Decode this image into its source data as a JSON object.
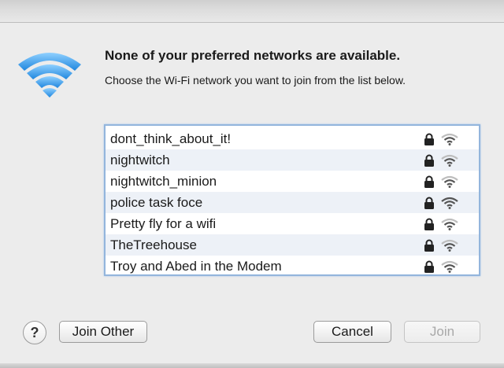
{
  "dialog": {
    "heading": "None of your preferred networks are available.",
    "subtext": "Choose the Wi-Fi network you want to join from the list below."
  },
  "networks": [
    {
      "name": "dont_think_about_it!",
      "secured": true,
      "signal_bars": 3
    },
    {
      "name": "nightwitch",
      "secured": true,
      "signal_bars": 3
    },
    {
      "name": "nightwitch_minion",
      "secured": true,
      "signal_bars": 3
    },
    {
      "name": "police task foce",
      "secured": true,
      "signal_bars": 4
    },
    {
      "name": "Pretty fly for a wifi",
      "secured": true,
      "signal_bars": 3
    },
    {
      "name": "TheTreehouse",
      "secured": true,
      "signal_bars": 3
    },
    {
      "name": "Troy and Abed in the Modem",
      "secured": true,
      "signal_bars": 3
    }
  ],
  "buttons": {
    "help": "?",
    "join_other": "Join Other",
    "cancel": "Cancel",
    "join": "Join"
  },
  "colors": {
    "wifi_accent": "#3aa0e8",
    "list_border": "#93b5dc",
    "row_stripe": "#edf1f7"
  },
  "icons": {
    "logo": "wifi-logo-icon",
    "lock": "lock-icon",
    "signal": "wifi-signal-icon"
  }
}
